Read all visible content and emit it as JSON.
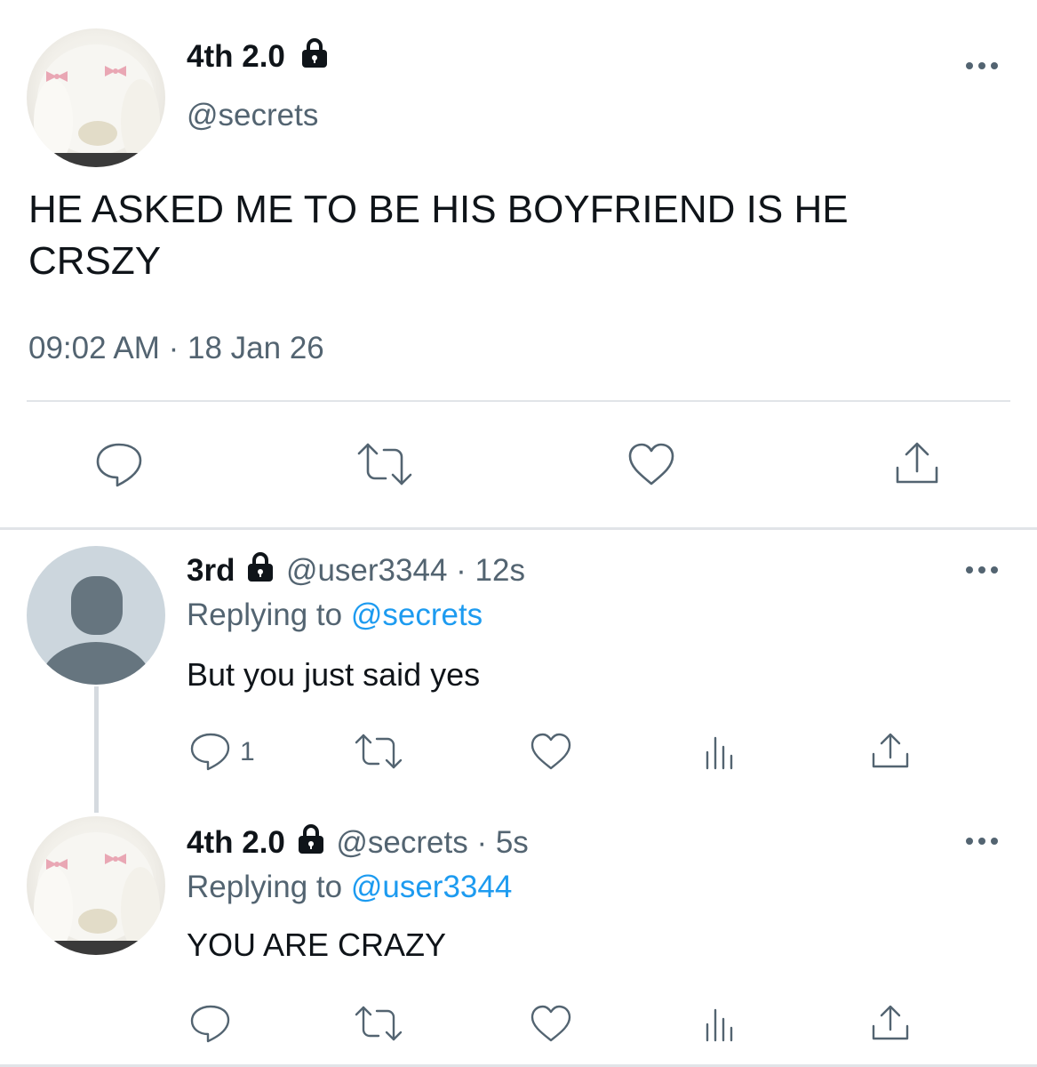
{
  "main_tweet": {
    "display_name": "4th 2.0",
    "handle": "@secrets",
    "text_line1": "HE ASKED ME TO BE HIS BOYFRIEND IS HE",
    "text_line2": "CRSZY",
    "time": "09:02 AM",
    "date": "18 Jan 26",
    "icons": [
      "reply-icon",
      "retweet-icon",
      "like-icon",
      "share-icon"
    ]
  },
  "replies": [
    {
      "display_name": "3rd",
      "handle": "@user3344",
      "age": "12s",
      "replying_to_label": "Replying to",
      "replying_to": "@secrets",
      "text": "But you just said yes",
      "reply_count": "1"
    },
    {
      "display_name": "4th 2.0",
      "handle": "@secrets",
      "age": "5s",
      "replying_to_label": "Replying to",
      "replying_to": "@user3344",
      "text": "YOU ARE CRAZY"
    }
  ],
  "separator": "·",
  "colors": {
    "accent": "#1d9bf0",
    "text": "#0f1419",
    "muted": "#536471",
    "divider": "#e1e4e8"
  }
}
